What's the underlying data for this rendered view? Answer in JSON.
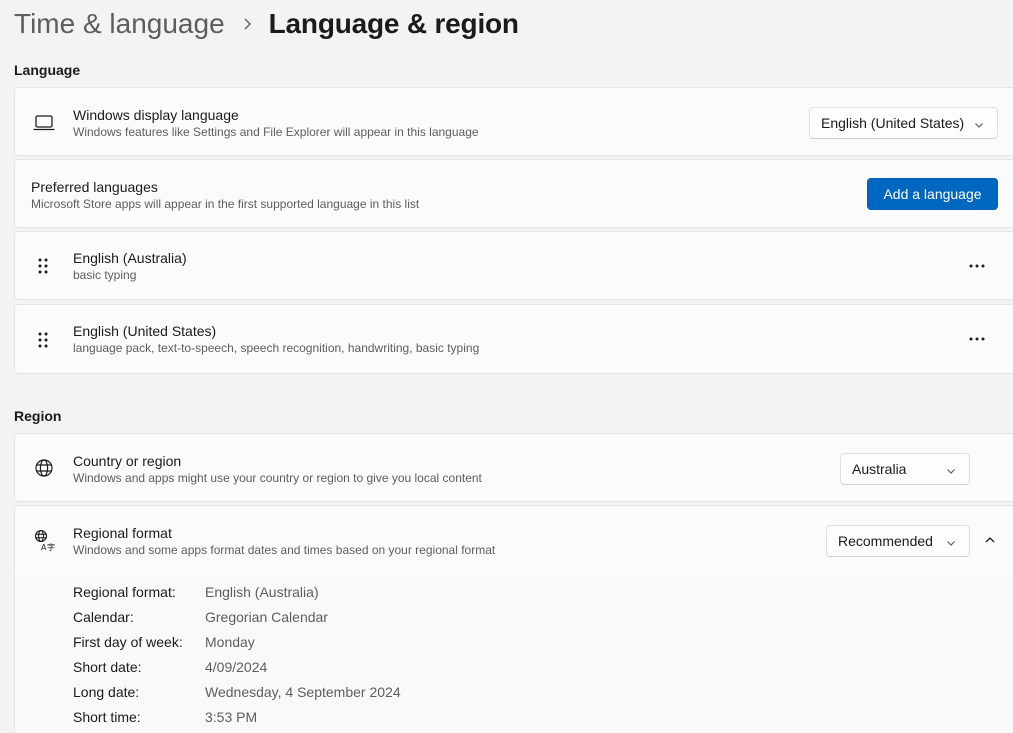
{
  "breadcrumb": {
    "parent": "Time & language",
    "current": "Language & region"
  },
  "sections": {
    "language": "Language",
    "region": "Region"
  },
  "display_language": {
    "icon": "laptop-icon",
    "title": "Windows display language",
    "description": "Windows features like Settings and File Explorer will appear in this language",
    "value": "English (United States)"
  },
  "preferred_languages": {
    "title": "Preferred languages",
    "description": "Microsoft Store apps will appear in the first supported language in this list",
    "add_button": "Add a language",
    "items": [
      {
        "name": "English (Australia)",
        "features": "basic typing"
      },
      {
        "name": "English (United States)",
        "features": "language pack, text-to-speech, speech recognition, handwriting, basic typing"
      }
    ]
  },
  "country": {
    "icon": "globe-icon",
    "title": "Country or region",
    "description": "Windows and apps might use your country or region to give you local content",
    "value": "Australia"
  },
  "regional_format": {
    "icon": "language-format-icon",
    "title": "Regional format",
    "description": "Windows and some apps format dates and times based on your regional format",
    "value": "Recommended",
    "details": [
      {
        "label": "Regional format:",
        "value": "English (Australia)"
      },
      {
        "label": "Calendar:",
        "value": "Gregorian Calendar"
      },
      {
        "label": "First day of week:",
        "value": "Monday"
      },
      {
        "label": "Short date:",
        "value": "4/09/2024"
      },
      {
        "label": "Long date:",
        "value": "Wednesday, 4 September 2024"
      },
      {
        "label": "Short time:",
        "value": "3:53 PM"
      }
    ]
  },
  "colors": {
    "accent": "#0067c0",
    "page_bg": "#f3f3f3",
    "card_bg": "#fbfbfb",
    "secondary_text": "#5d5d5d"
  }
}
